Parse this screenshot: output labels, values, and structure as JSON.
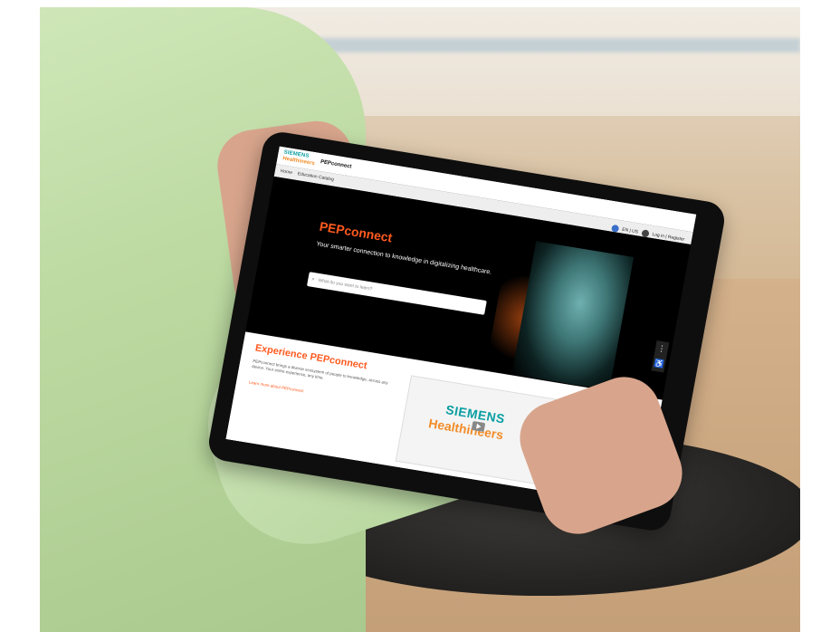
{
  "screen": {
    "brand": {
      "line1": "SIEMENS",
      "line2": "Healthineers"
    },
    "app_name": "PEPconnect",
    "nav": {
      "home": "Home",
      "catalog": "Education Catalog"
    },
    "top_right": {
      "language": "EN | US",
      "login": "Log in | Register"
    },
    "hero": {
      "title": "PEPconnect",
      "subtitle": "Your smarter connection to knowledge in digitalizing healthcare.",
      "search_placeholder": "What do you want to learn?"
    },
    "experience": {
      "title": "Experience PEPconnect",
      "text": "PEPconnect brings a diverse ecosystem of people to knowledge, across any device. Your entire experience, any time.",
      "link": "Learn more about PEPconnect"
    },
    "video_card": {
      "brand1": "SIEMENS",
      "brand2": "Healthineers"
    }
  },
  "colors": {
    "accent": "#ff5a1f",
    "teal": "#0b9ea2",
    "orange": "#f28c28"
  },
  "icons": {
    "search": "search-icon",
    "play": "play-icon",
    "accessibility": "accessibility-icon",
    "language": "globe-icon",
    "user": "user-icon"
  }
}
